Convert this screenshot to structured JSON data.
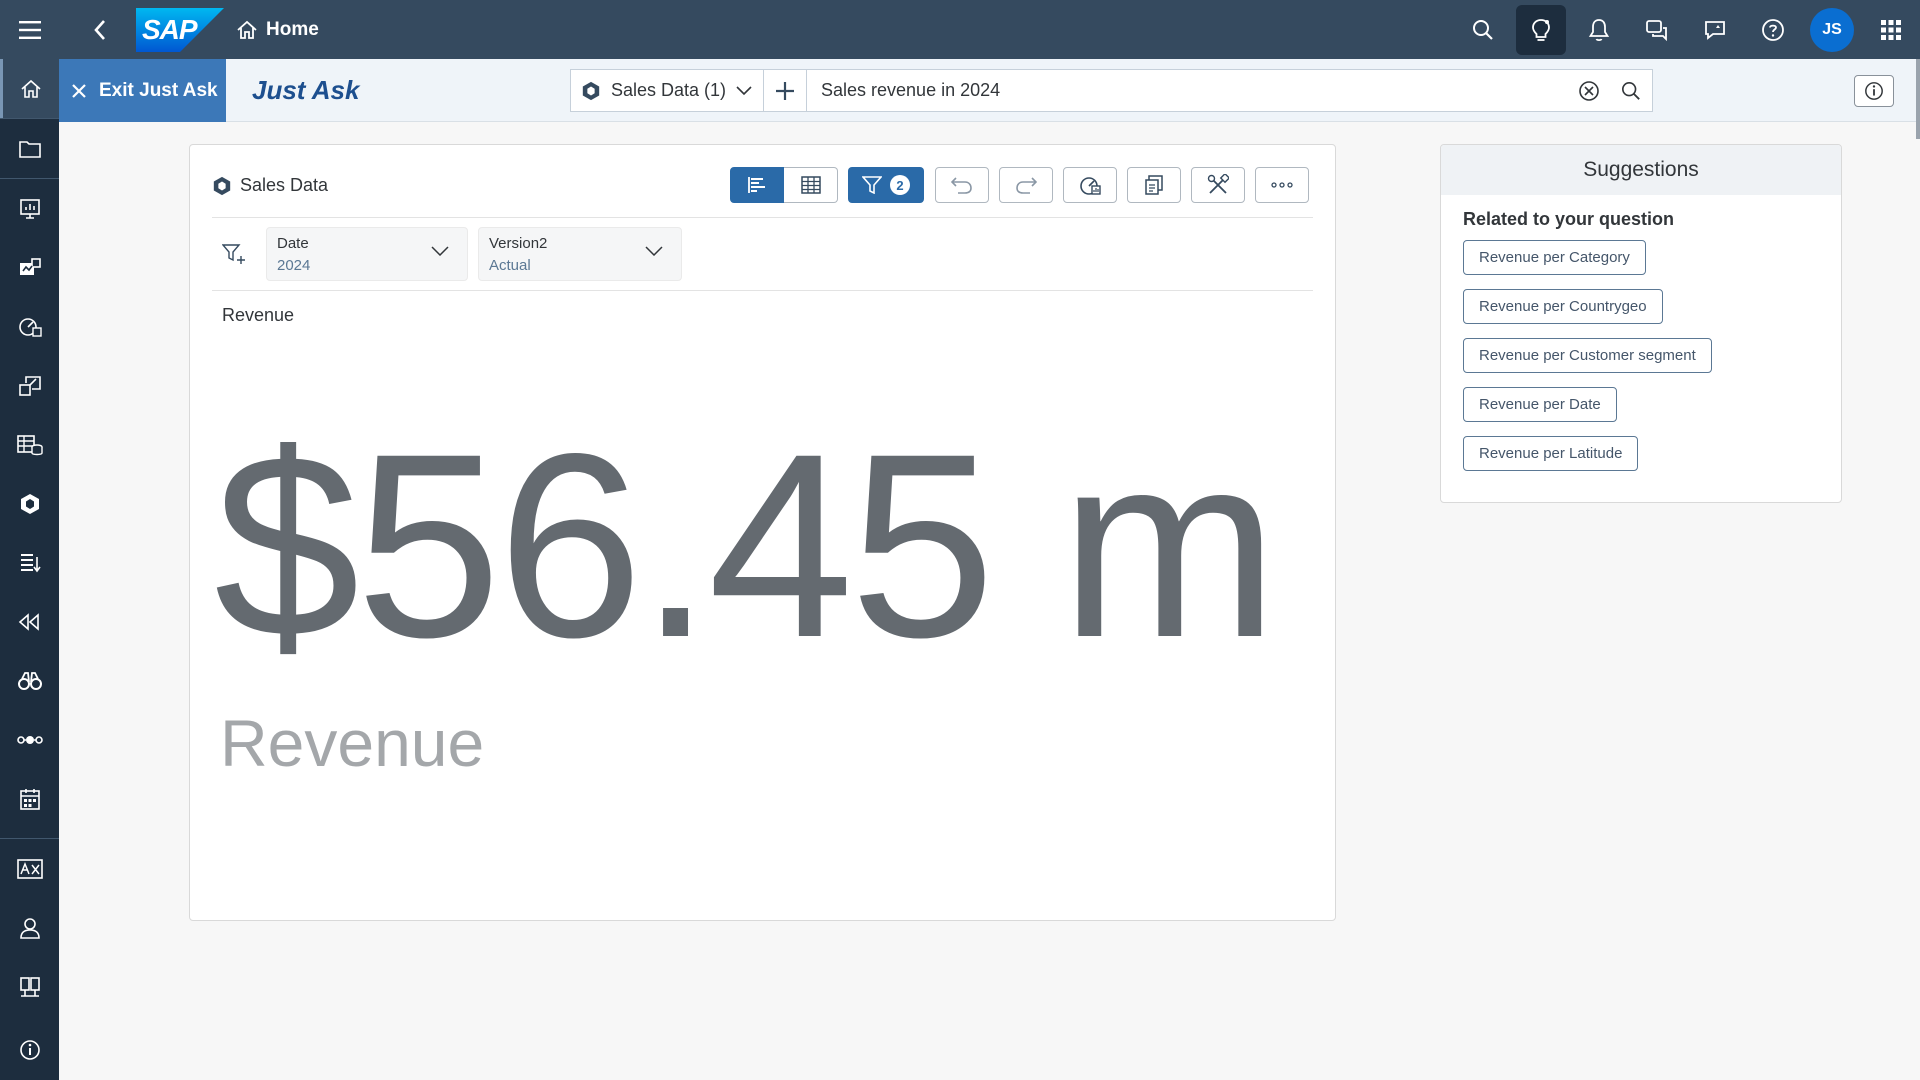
{
  "shell": {
    "logo_text": "SAP",
    "home_label": "Home",
    "avatar_initials": "JS",
    "colors": {
      "shell_bg": "#354a5f",
      "nav_bg": "#1d2d3e",
      "accent": "#0a6ed1"
    }
  },
  "leftnav": {
    "items": [
      "home-icon",
      "folder-icon",
      "stories-icon",
      "analytic-apps-icon",
      "digital-boardroom-icon",
      "data-analyzer-icon",
      "datasets-icon",
      "modeler-icon",
      "data-actions-icon",
      "multi-actions-icon",
      "insights-icon",
      "connections-icon",
      "calendar-icon",
      "translation-icon",
      "user-icon",
      "system-monitor-icon",
      "about-icon"
    ]
  },
  "subheader": {
    "exit_label": "Exit Just Ask",
    "title": "Just Ask",
    "model_select_value": "Sales Data (1)",
    "query_value": "Sales revenue in 2024"
  },
  "card": {
    "title": "Sales Data",
    "filter_badge": "2",
    "filters": [
      {
        "label": "Date",
        "value": "2024"
      },
      {
        "label": "Version2",
        "value": "Actual"
      }
    ],
    "chart_label": "Revenue",
    "kpi_value": "$56.45 m",
    "kpi_label": "Revenue"
  },
  "suggestions": {
    "title": "Suggestions",
    "subtitle": "Related to your question",
    "items": [
      "Revenue per Category",
      "Revenue per Countrygeo",
      "Revenue per Customer segment",
      "Revenue per Date",
      "Revenue per Latitude"
    ]
  }
}
